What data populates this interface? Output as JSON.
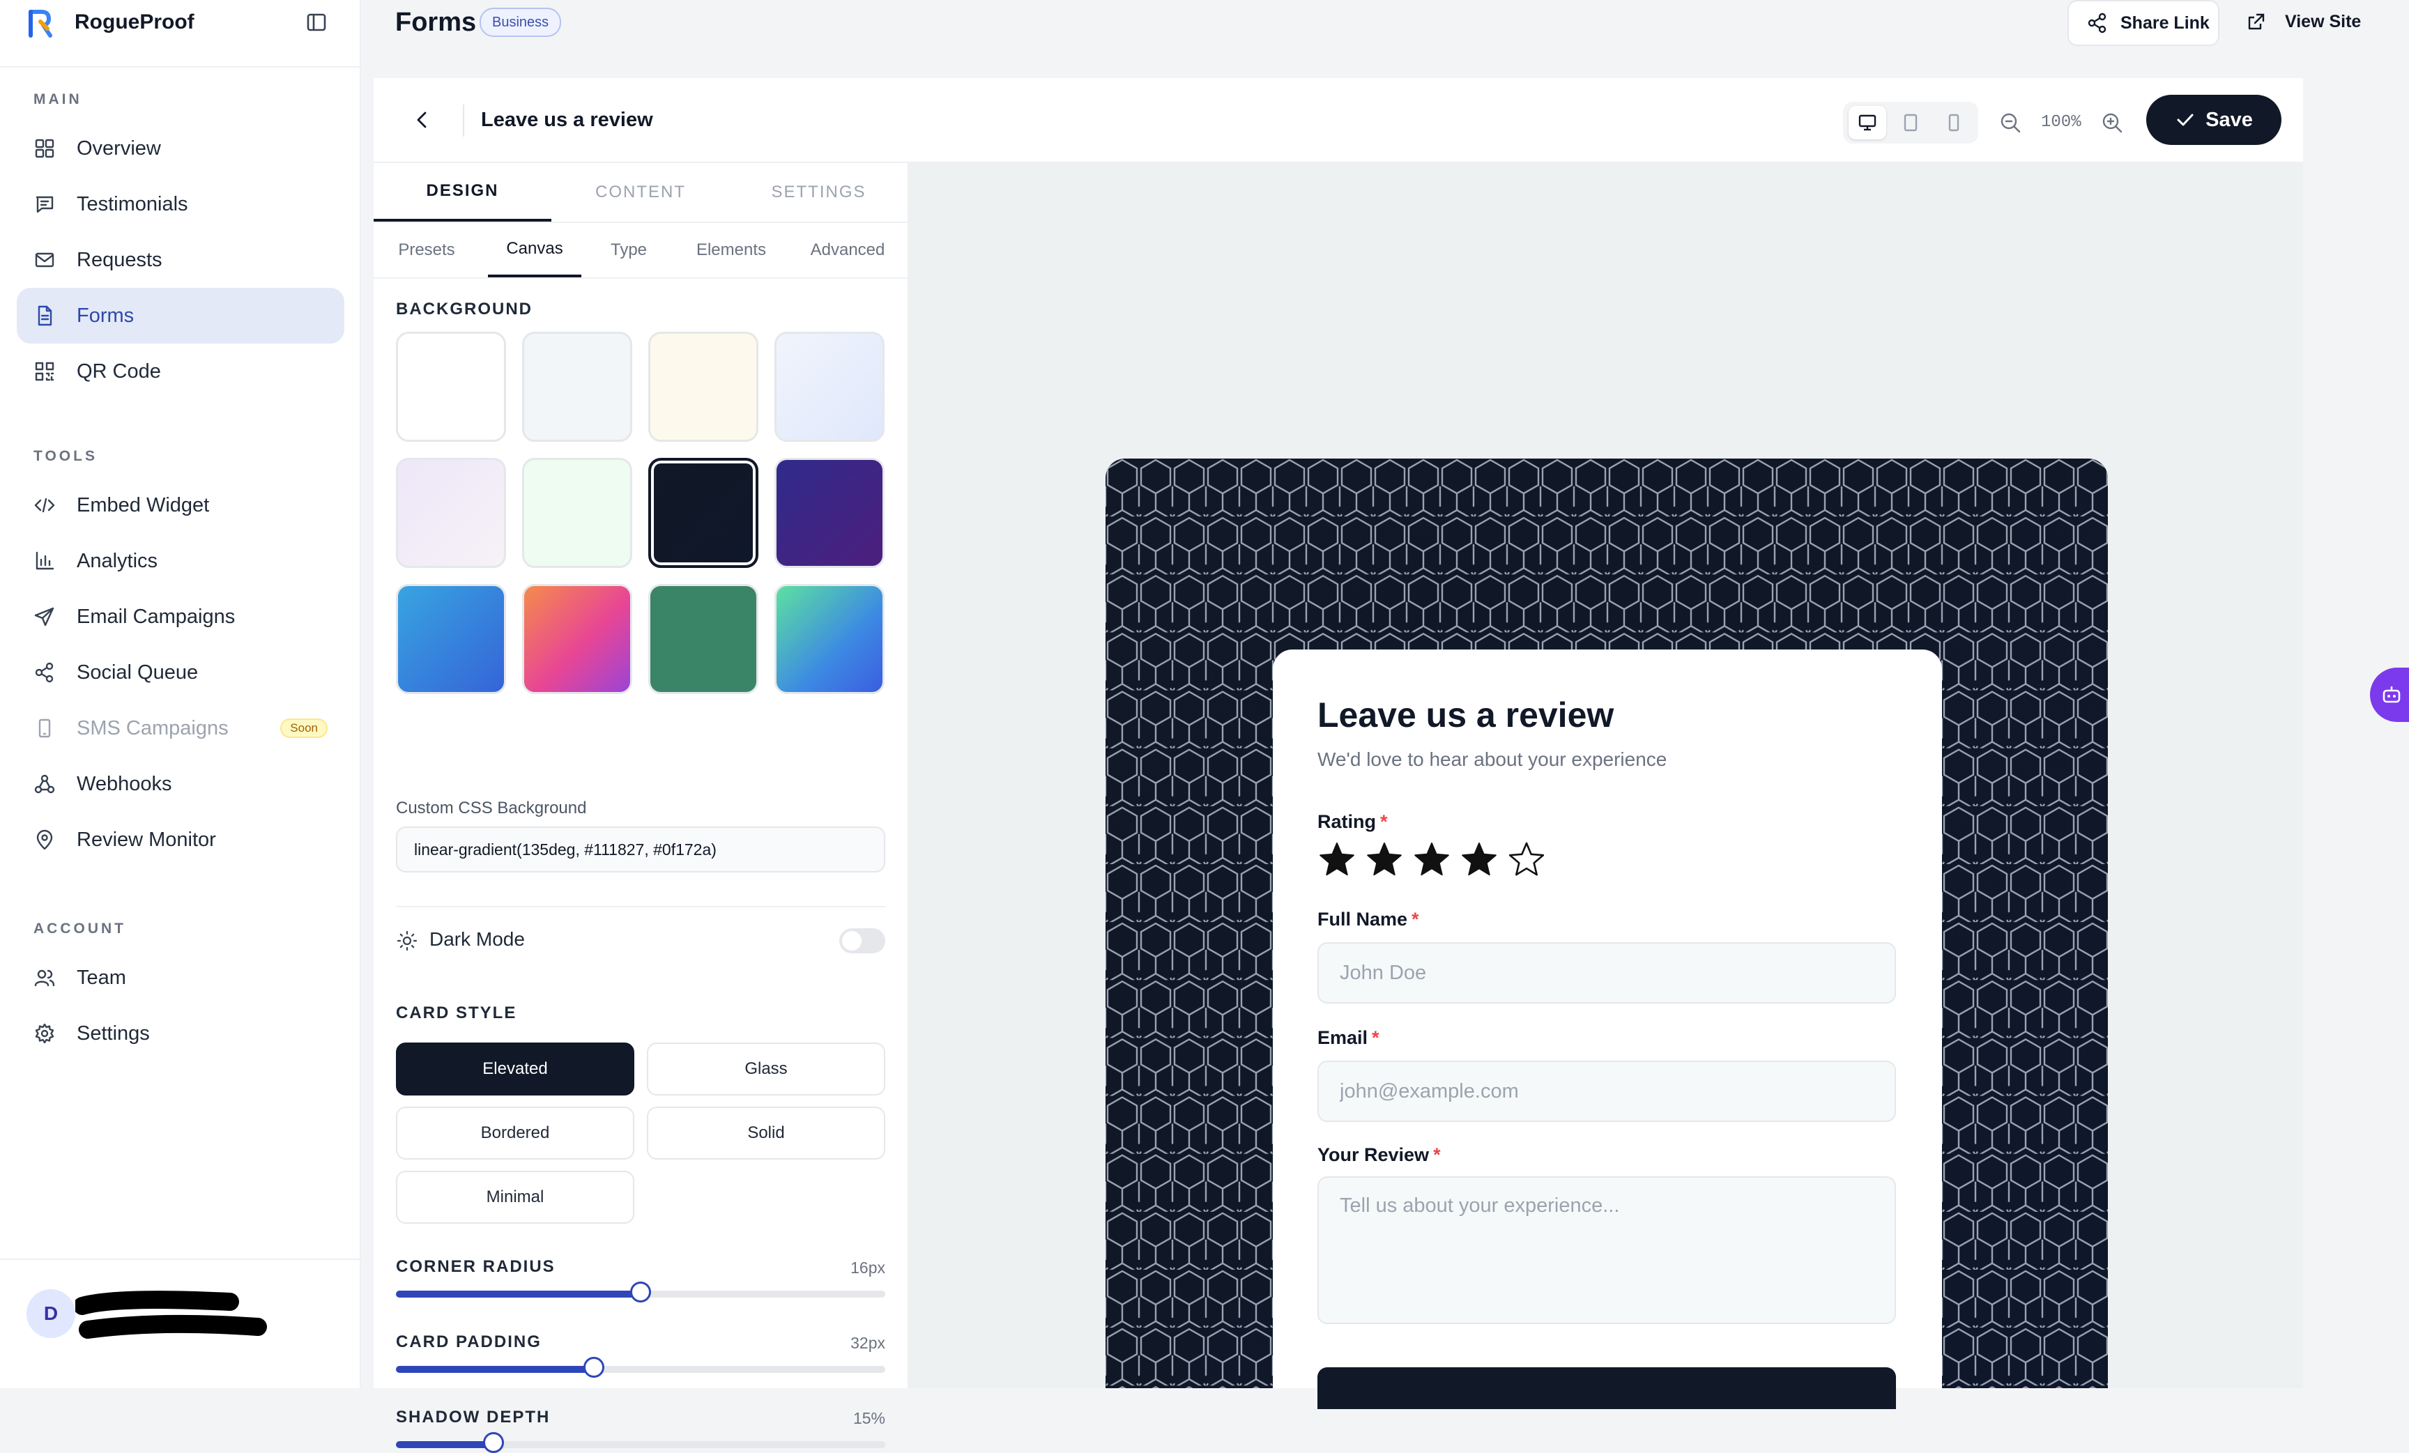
{
  "app": {
    "name": "RogueProof"
  },
  "sidebar": {
    "sections": {
      "main": "MAIN",
      "tools": "TOOLS",
      "account": "ACCOUNT"
    },
    "main_items": [
      {
        "label": "Overview",
        "icon": "grid-icon"
      },
      {
        "label": "Testimonials",
        "icon": "message-square-icon"
      },
      {
        "label": "Requests",
        "icon": "mail-icon"
      },
      {
        "label": "Forms",
        "icon": "file-text-icon",
        "active": true
      },
      {
        "label": "QR Code",
        "icon": "qr-code-icon"
      }
    ],
    "tools_items": [
      {
        "label": "Embed Widget",
        "icon": "code-icon"
      },
      {
        "label": "Analytics",
        "icon": "bar-chart-icon"
      },
      {
        "label": "Email Campaigns",
        "icon": "send-icon"
      },
      {
        "label": "Social Queue",
        "icon": "share-icon"
      },
      {
        "label": "SMS Campaigns",
        "icon": "smartphone-icon",
        "badge": "Soon",
        "disabled": true
      },
      {
        "label": "Webhooks",
        "icon": "webhook-icon"
      },
      {
        "label": "Review Monitor",
        "icon": "map-pin-icon"
      }
    ],
    "account_items": [
      {
        "label": "Team",
        "icon": "users-icon"
      },
      {
        "label": "Settings",
        "icon": "gear-icon"
      }
    ],
    "user": {
      "initial": "D"
    }
  },
  "topbar": {
    "title": "Forms",
    "plan_badge": "Business",
    "share_label": "Share Link",
    "view_site_label": "View Site"
  },
  "editor": {
    "form_title": "Leave us a review",
    "zoom": "100%",
    "save_label": "Save",
    "devices": [
      "desktop",
      "tablet",
      "mobile"
    ],
    "active_device": "desktop"
  },
  "panel": {
    "main_tabs": [
      {
        "label": "DESIGN",
        "active": true
      },
      {
        "label": "CONTENT"
      },
      {
        "label": "SETTINGS"
      }
    ],
    "sub_tabs": [
      {
        "label": "Presets"
      },
      {
        "label": "Canvas",
        "active": true
      },
      {
        "label": "Type"
      },
      {
        "label": "Elements"
      },
      {
        "label": "Advanced"
      }
    ],
    "background_label": "BACKGROUND",
    "swatches": [
      {
        "color": "#ffffff"
      },
      {
        "color": "#f3f6f9"
      },
      {
        "color": "#fdf9ec"
      },
      {
        "color": "linear-gradient(135deg,#f1f4fc,#dfe8fb)"
      },
      {
        "color": "linear-gradient(135deg,#ede7f8,#f6f2f7)"
      },
      {
        "color": "#effcf2"
      },
      {
        "color": "linear-gradient(135deg,#111827,#0f172a)",
        "selected": true
      },
      {
        "color": "linear-gradient(135deg,#302b8a,#4d1f7e)"
      },
      {
        "color": "linear-gradient(135deg,#38a4e0,#3564d8)"
      },
      {
        "color": "linear-gradient(135deg,#f58b4b,#e84695 55%,#9b44d6)"
      },
      {
        "color": "#3a8567"
      },
      {
        "color": "linear-gradient(135deg,#5de0a0,#3c8ae3 60%,#3b5de0)"
      }
    ],
    "custom_css_label": "Custom CSS Background",
    "custom_css_value": "linear-gradient(135deg, #111827, #0f172a)",
    "dark_mode_label": "Dark Mode",
    "dark_mode_on": false,
    "card_style_label": "CARD STYLE",
    "card_styles": [
      {
        "label": "Elevated",
        "active": true
      },
      {
        "label": "Glass"
      },
      {
        "label": "Bordered"
      },
      {
        "label": "Solid"
      },
      {
        "label": "Minimal"
      }
    ],
    "sliders": [
      {
        "label": "CORNER RADIUS",
        "value_text": "16px",
        "fraction": 0.5
      },
      {
        "label": "CARD PADDING",
        "value_text": "32px",
        "fraction": 0.405
      },
      {
        "label": "SHADOW DEPTH",
        "value_text": "15%",
        "fraction": 0.2
      }
    ]
  },
  "preview_form": {
    "title": "Leave us a review",
    "subtitle": "We'd love to hear about your experience",
    "rating_label": "Rating",
    "rating_value": 4,
    "rating_max": 5,
    "required_mark": "*",
    "name_label": "Full Name",
    "name_placeholder": "John Doe",
    "email_label": "Email",
    "email_placeholder": "john@example.com",
    "review_label": "Your Review",
    "review_placeholder": "Tell us about your experience..."
  },
  "colors": {
    "accent": "#2f46b8",
    "primary": "#111827",
    "active_nav_bg": "#e4e9f7",
    "required": "#ef4444",
    "assistant": "#7c3aed"
  }
}
